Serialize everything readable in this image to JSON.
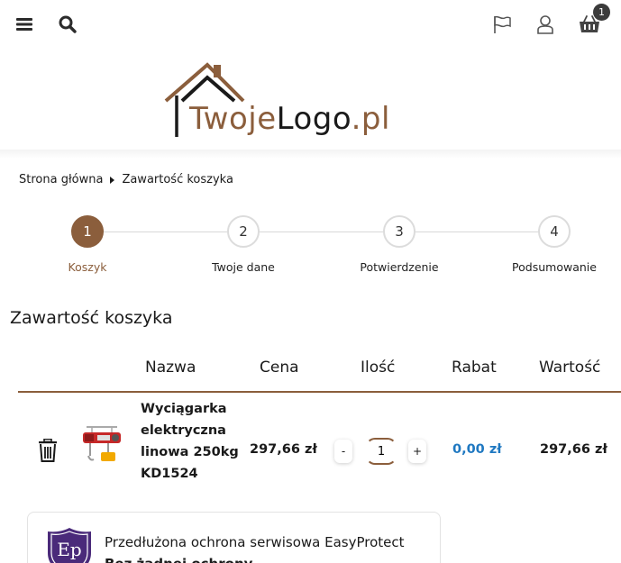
{
  "header": {
    "cart_count": "1",
    "icons": [
      "menu-icon",
      "search-icon",
      "flag-icon",
      "user-icon",
      "cart-icon"
    ]
  },
  "logo": {
    "part1": "Twoje",
    "part2": "Logo",
    "part3": ".pl"
  },
  "breadcrumb": {
    "home": "Strona główna",
    "current": "Zawartość koszyka"
  },
  "steps": [
    {
      "number": "1",
      "label": "Koszyk",
      "active": true
    },
    {
      "number": "2",
      "label": "Twoje dane",
      "active": false
    },
    {
      "number": "3",
      "label": "Potwierdzenie",
      "active": false
    },
    {
      "number": "4",
      "label": "Podsumowanie",
      "active": false
    }
  ],
  "cart": {
    "title": "Zawartość koszyka",
    "columns": {
      "name": "Nazwa",
      "price": "Cena",
      "qty": "Ilość",
      "discount": "Rabat",
      "value": "Wartość"
    },
    "items": [
      {
        "name": "Wyciągarka elektryczna linowa 250kg KD1524",
        "price": "297,66 zł",
        "qty_minus": "-",
        "qty": "1",
        "qty_plus": "+",
        "discount": "0,00 zł",
        "value": "297,66 zł"
      }
    ]
  },
  "warranty": {
    "logo_text": "Ep",
    "title": "Przedłużona ochrona serwisowa EasyProtect",
    "subtitle": "Bez żadnej ochrony"
  },
  "colors": {
    "accent": "#8b5e3c",
    "discount": "#1f78c1",
    "badge": "#3b3b3b"
  }
}
